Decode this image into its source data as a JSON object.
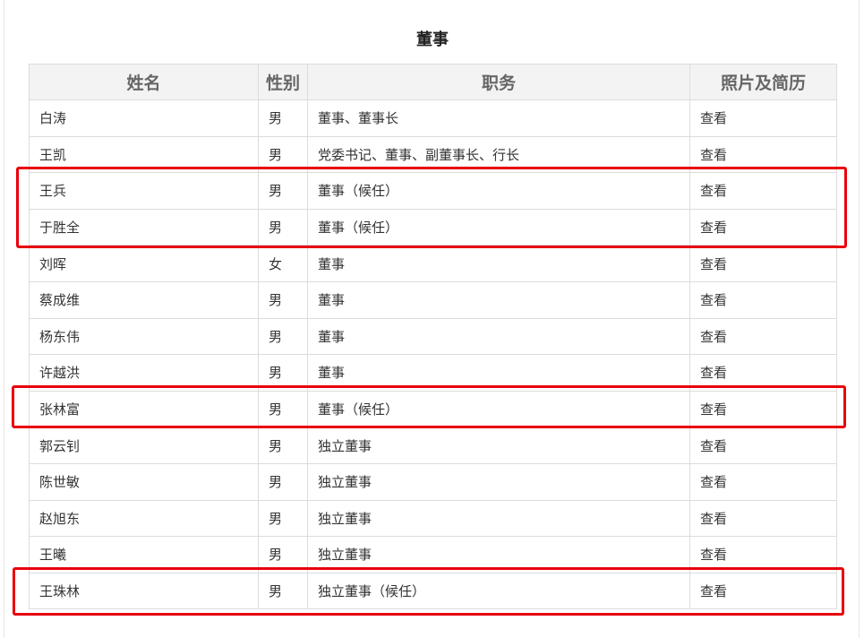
{
  "title": "董事",
  "columns": [
    "姓名",
    "性别",
    "职务",
    "照片及简历"
  ],
  "rows": [
    {
      "name": "白涛",
      "gender": "男",
      "role": "董事、董事长",
      "link": "查看"
    },
    {
      "name": "王凯",
      "gender": "男",
      "role": "党委书记、董事、副董事长、行长",
      "link": "查看"
    },
    {
      "name": "王兵",
      "gender": "男",
      "role": "董事（候任）",
      "link": "查看"
    },
    {
      "name": "于胜全",
      "gender": "男",
      "role": "董事（候任）",
      "link": "查看"
    },
    {
      "name": "刘晖",
      "gender": "女",
      "role": "董事",
      "link": "查看"
    },
    {
      "name": "蔡成维",
      "gender": "男",
      "role": "董事",
      "link": "查看"
    },
    {
      "name": "杨东伟",
      "gender": "男",
      "role": "董事",
      "link": "查看"
    },
    {
      "name": "许越洪",
      "gender": "男",
      "role": "董事",
      "link": "查看"
    },
    {
      "name": "张林富",
      "gender": "男",
      "role": "董事（候任）",
      "link": "查看"
    },
    {
      "name": "郭云钊",
      "gender": "男",
      "role": "独立董事",
      "link": "查看"
    },
    {
      "name": "陈世敏",
      "gender": "男",
      "role": "独立董事",
      "link": "查看"
    },
    {
      "name": "赵旭东",
      "gender": "男",
      "role": "独立董事",
      "link": "查看"
    },
    {
      "name": "王曦",
      "gender": "男",
      "role": "独立董事",
      "link": "查看"
    },
    {
      "name": "王珠林",
      "gender": "男",
      "role": "独立董事（候任）",
      "link": "查看"
    }
  ],
  "highlight_color": "#e8000b",
  "highlighted_rows": [
    [
      3,
      4
    ],
    [
      9,
      9
    ],
    [
      14,
      14
    ]
  ]
}
